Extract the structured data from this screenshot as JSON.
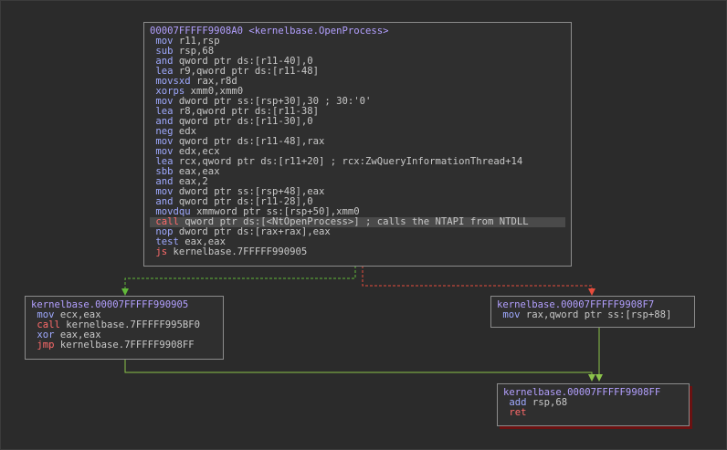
{
  "colors": {
    "background": "#2b2b2b",
    "block_bg": "#2f2f2f",
    "label": "#b3a0ff",
    "mnemonic": "#9fa9ff",
    "flow_mnemonic": "#ff6b6b",
    "number": "#ff6b6b",
    "true_edge": "#62b93a",
    "false_edge": "#e74c3c",
    "plain_edge": "#8bc34a"
  },
  "blocks": {
    "main": {
      "header": "00007FFFFF9908A0 <kernelbase.OpenProcess>",
      "lines": [
        {
          "mn": "mov",
          "ops": "r11,rsp"
        },
        {
          "mn": "sub",
          "ops": "rsp,68"
        },
        {
          "mn": "and",
          "ops": "qword ptr ds:[r11-40],0"
        },
        {
          "mn": "lea",
          "ops": "r9,qword ptr ds:[r11-48]"
        },
        {
          "mn": "movsxd",
          "ops": "rax,r8d"
        },
        {
          "mn": "xorps",
          "ops": "xmm0,xmm0"
        },
        {
          "mn": "mov",
          "ops": "dword ptr ss:[rsp+30],30 ; 30:'0'"
        },
        {
          "mn": "lea",
          "ops": "r8,qword ptr ds:[r11-38]"
        },
        {
          "mn": "and",
          "ops": "qword ptr ds:[r11-30],0"
        },
        {
          "mn": "neg",
          "ops": "edx"
        },
        {
          "mn": "mov",
          "ops": "qword ptr ds:[r11-48],rax"
        },
        {
          "mn": "mov",
          "ops": "edx,ecx"
        },
        {
          "mn": "lea",
          "ops": "rcx,qword ptr ds:[r11+20] ; rcx:ZwQueryInformationThread+14"
        },
        {
          "mn": "sbb",
          "ops": "eax,eax"
        },
        {
          "mn": "and",
          "ops": "eax,2"
        },
        {
          "mn": "mov",
          "ops": "dword ptr ss:[rsp+48],eax"
        },
        {
          "mn": "and",
          "ops": "qword ptr ds:[r11-28],0"
        },
        {
          "mn": "movdqu",
          "ops": "xmmword ptr ss:[rsp+50],xmm0"
        },
        {
          "mn": "call",
          "ops": "qword ptr ds:[<NtOpenProcess>] ; calls the NTAPI from NTDLL"
        },
        {
          "mn": "nop",
          "ops": "dword ptr ds:[rax+rax],eax"
        },
        {
          "mn": "test",
          "ops": "eax,eax"
        },
        {
          "mn": "js",
          "ops": "kernelbase.7FFFFF990905"
        }
      ]
    },
    "left": {
      "header": "kernelbase.00007FFFFF990905",
      "lines": [
        {
          "mn": "mov",
          "ops": "ecx,eax"
        },
        {
          "mn": "call",
          "ops": "kernelbase.7FFFFF995BF0"
        },
        {
          "mn": "xor",
          "ops": "eax,eax"
        },
        {
          "mn": "jmp",
          "ops": "kernelbase.7FFFFF9908FF"
        }
      ]
    },
    "right": {
      "header": "kernelbase.00007FFFFF9908F7",
      "lines": [
        {
          "mn": "mov",
          "ops": "rax,qword ptr ss:[rsp+88]"
        }
      ]
    },
    "bottom": {
      "header": "kernelbase.00007FFFFF9908FF",
      "lines": [
        {
          "mn": "add",
          "ops": "rsp,68"
        },
        {
          "mn": "ret",
          "ops": ""
        }
      ]
    }
  }
}
